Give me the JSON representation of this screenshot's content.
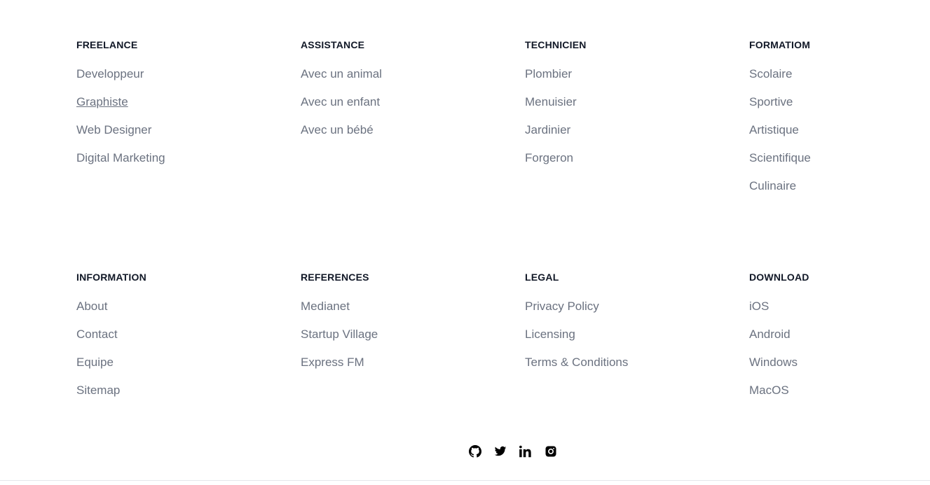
{
  "sections_row1": [
    {
      "title": "FREELANCE",
      "links": [
        "Developpeur",
        "Graphiste",
        "Web Designer",
        "Digital Marketing"
      ]
    },
    {
      "title": "ASSISTANCE",
      "links": [
        "Avec un animal",
        "Avec un enfant",
        "Avec un bébé"
      ]
    },
    {
      "title": "TECHNICIEN",
      "links": [
        "Plombier",
        "Menuisier",
        "Jardinier",
        "Forgeron"
      ]
    },
    {
      "title": "FORMATIOM",
      "links": [
        "Scolaire",
        "Sportive",
        "Artistique",
        "Scientifique",
        "Culinaire"
      ]
    }
  ],
  "sections_row2": [
    {
      "title": "INFORMATION",
      "links": [
        "About",
        "Contact",
        "Equipe",
        "Sitemap"
      ]
    },
    {
      "title": "REFERENCES",
      "links": [
        "Medianet",
        "Startup Village",
        "Express FM"
      ]
    },
    {
      "title": "LEGAL",
      "links": [
        "Privacy Policy",
        "Licensing",
        "Terms & Conditions"
      ]
    },
    {
      "title": "DOWNLOAD",
      "links": [
        "iOS",
        "Android",
        "Windows",
        "MacOS"
      ]
    }
  ],
  "social_icons": [
    "github-icon",
    "twitter-icon",
    "linkedin-icon",
    "instagram-icon"
  ],
  "colors": {
    "heading": "#111827",
    "link": "#6b7280",
    "icon": "#000000",
    "divider": "#e5e7eb"
  }
}
